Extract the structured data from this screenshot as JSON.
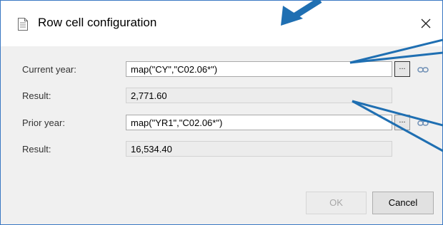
{
  "dialog": {
    "title": "Row cell configuration",
    "close_glyph": "✕"
  },
  "rows": {
    "current_year_label": "Current year:",
    "current_year_value": "map(\"CY\",\"C02.06*\")",
    "current_result_label": "Result:",
    "current_result_value": "2,771.60",
    "prior_year_label": "Prior year:",
    "prior_year_value": "map(\"YR1\",\"C02.06*\")",
    "prior_result_label": "Result:",
    "prior_result_value": "16,534.40",
    "browse_label": "..."
  },
  "buttons": {
    "ok_label": "OK",
    "cancel_label": "Cancel"
  },
  "colors": {
    "annotation_arrow": "#1f6fb2",
    "dialog_border": "#3a78c3"
  },
  "icons": [
    "document-icon",
    "close-icon",
    "link-icon",
    "annotation-arrow"
  ]
}
